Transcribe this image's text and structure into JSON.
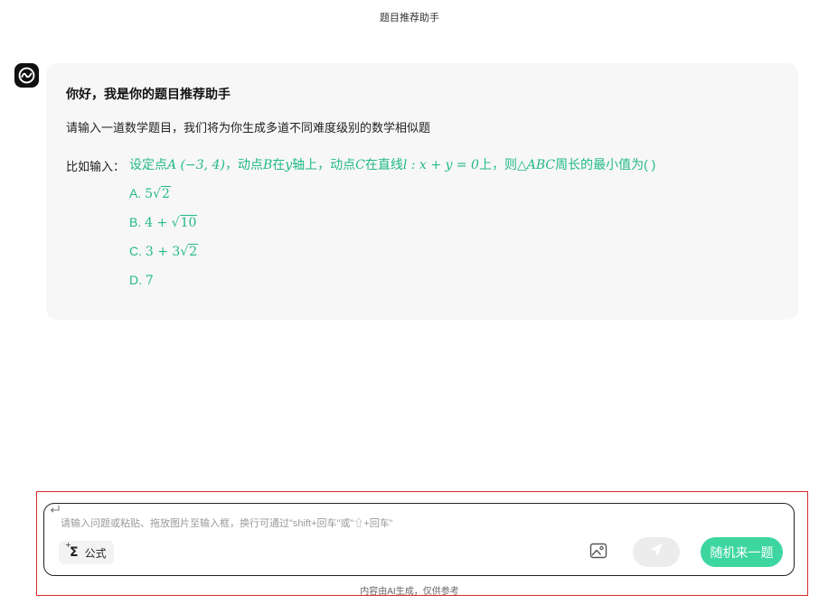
{
  "header": {
    "title": "题目推荐助手"
  },
  "assistant_message": {
    "greeting": "你好，我是你的题目推荐助手",
    "intro": "请输入一道数学题目，我们将为你生成多道不同难度级别的数学相似题",
    "example_label": "比如输入：",
    "example_question": {
      "t1": "设定点",
      "m1": "A (−3, 4)",
      "t2": "，动点",
      "m2": "B",
      "t3": "在",
      "m3": "y",
      "t4": "轴上，动点",
      "m4": "C",
      "t5": "在直线",
      "m5": "l : x + y = 0",
      "t6": "上，则",
      "m6": "△ABC",
      "t7": "周长的最小值为( )"
    },
    "options": {
      "a": {
        "letter": "A.",
        "pre": "5",
        "radicand": "2"
      },
      "b": {
        "letter": "B.",
        "pre": "4 + ",
        "radicand": "10"
      },
      "c": {
        "letter": "C.",
        "pre": "3 + 3",
        "radicand": "2"
      },
      "d": {
        "letter": "D.",
        "value": "7"
      }
    }
  },
  "composer": {
    "placeholder": "请输入问题或粘贴、拖放图片至输入框，换行可通过\"shift+回车\"或\"⇧+回车\"",
    "formula_label": "公式",
    "random_label": "随机来一题"
  },
  "footer": {
    "note": "内容由AI生成，仅供参考"
  },
  "colors": {
    "accent": "#3dd6a0",
    "math_text": "#21b985",
    "bubble_bg": "#f7f7f7",
    "selection_outline": "#d92b2b"
  },
  "icons": [
    "assistant-logo-icon",
    "newline-icon",
    "sigma-icon",
    "image-icon",
    "send-icon"
  ]
}
